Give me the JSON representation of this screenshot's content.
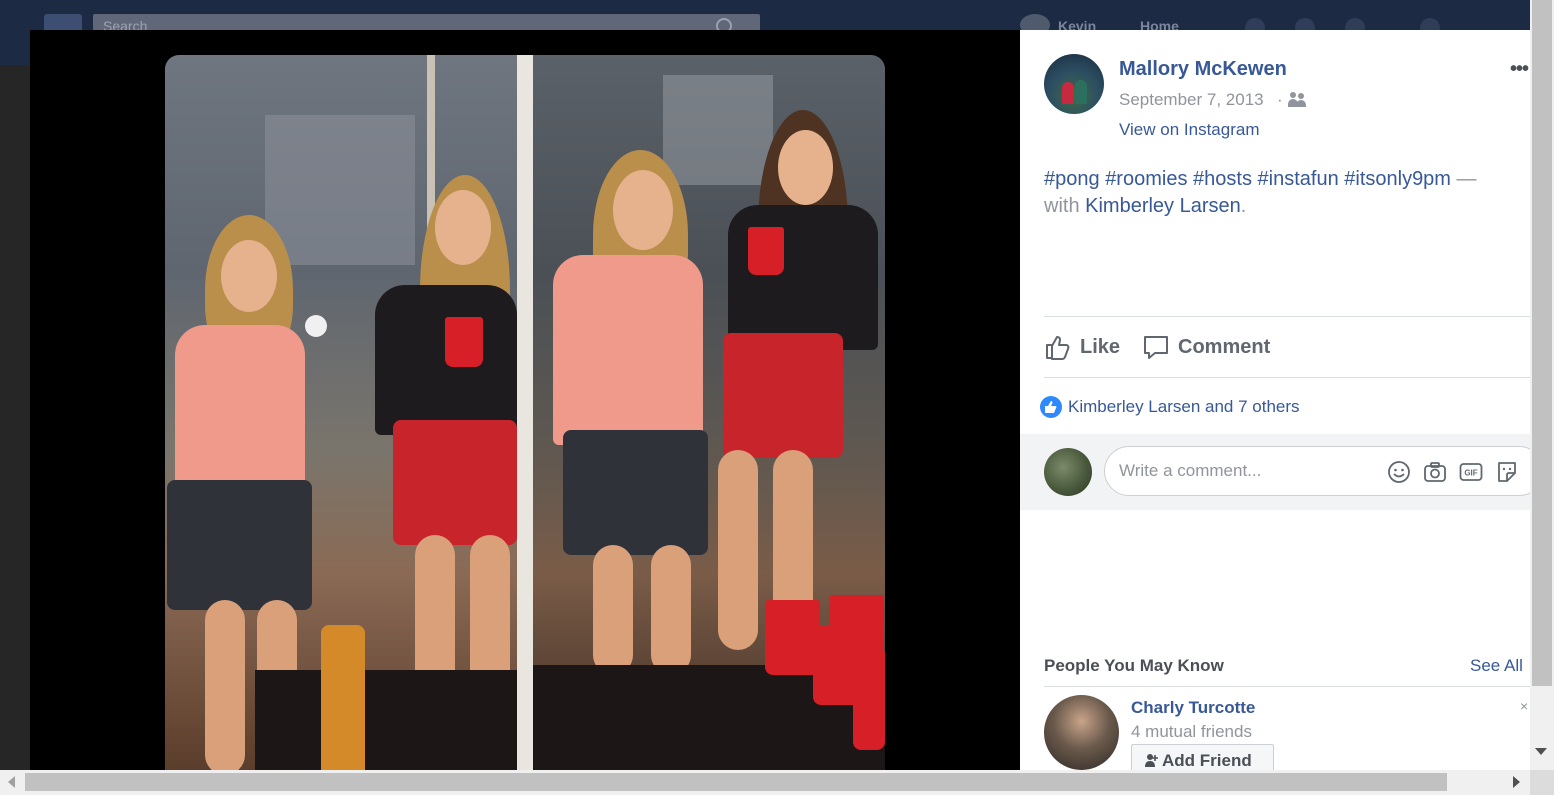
{
  "topbar": {
    "search_placeholder": "Search",
    "user_name": "Kevin",
    "home_label": "Home"
  },
  "post": {
    "author": "Mallory McKewen",
    "date": "September 7, 2013",
    "separator": "·",
    "audience_icon": "friends-icon",
    "source_link": "View on Instagram",
    "more_label": "•••",
    "caption": {
      "hashtags": [
        "#pong",
        "#roomies",
        "#hosts",
        "#instafun",
        "#itsonly9pm"
      ],
      "with_text": "— with",
      "tagged_person": "Kimberley Larsen",
      "end": "."
    },
    "actions": {
      "like": "Like",
      "comment": "Comment"
    },
    "reactions": {
      "text": "Kimberley Larsen and 7 others"
    },
    "comment_box": {
      "placeholder": "Write a comment..."
    }
  },
  "people_you_may_know": {
    "title": "People You May Know",
    "see_all": "See All",
    "suggestion": {
      "name": "Charly Turcotte",
      "mutual": "4 mutual friends",
      "add_label": "Add Friend",
      "dismiss": "×"
    }
  },
  "colors": {
    "link": "#385898",
    "secondary_text": "#90949c",
    "like_badge": "#2e89ff"
  }
}
